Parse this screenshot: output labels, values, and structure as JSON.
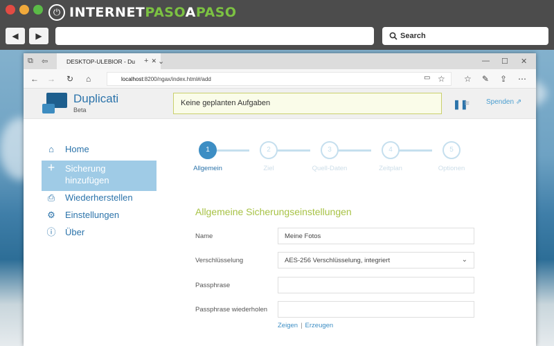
{
  "site": {
    "brand_part1": "INTERNET",
    "brand_part2": "PASO",
    "brand_part3": "A",
    "brand_part4": "PASO",
    "search_label": "Search"
  },
  "browser": {
    "tab_title": "DESKTOP-ULEBIOR - Du",
    "url_host": "localhost",
    "url_path": ":8200/ngax/index.html#/add"
  },
  "app": {
    "name": "Duplicati",
    "edition": "Beta",
    "status_text": "Keine geplanten Aufgaben",
    "donate_label": "Spenden"
  },
  "sidebar": {
    "items": [
      {
        "label": "Home",
        "icon": "home-icon"
      },
      {
        "label": "Sicherung hinzufügen",
        "label_line1": "Sicherung",
        "label_line2": "hinzufügen",
        "icon": "plus-icon"
      },
      {
        "label": "Wiederherstellen",
        "icon": "restore-icon"
      },
      {
        "label": "Einstellungen",
        "icon": "gear-icon"
      },
      {
        "label": "Über",
        "icon": "info-icon"
      }
    ]
  },
  "wizard": {
    "steps": [
      {
        "num": "1",
        "label": "Allgemein"
      },
      {
        "num": "2",
        "label": "Ziel"
      },
      {
        "num": "3",
        "label": "Quell-Daten"
      },
      {
        "num": "4",
        "label": "Zeitplan"
      },
      {
        "num": "5",
        "label": "Optionen"
      }
    ],
    "active_step": 1
  },
  "form": {
    "title": "Allgemeine Sicherungseinstellungen",
    "name_label": "Name",
    "name_value": "Meine Fotos",
    "encryption_label": "Verschlüsselung",
    "encryption_value": "AES-256 Verschlüsselung, integriert",
    "passphrase_label": "Passphrase",
    "passphrase_repeat_label": "Passphrase wiederholen",
    "show_link": "Zeigen",
    "link_separator": "|",
    "generate_link": "Erzeugen"
  },
  "colors": {
    "accent": "#2b73aa",
    "active_step": "#3d8ec4",
    "section_title": "#a7c245",
    "sidebar_active": "#9fcbe6"
  }
}
